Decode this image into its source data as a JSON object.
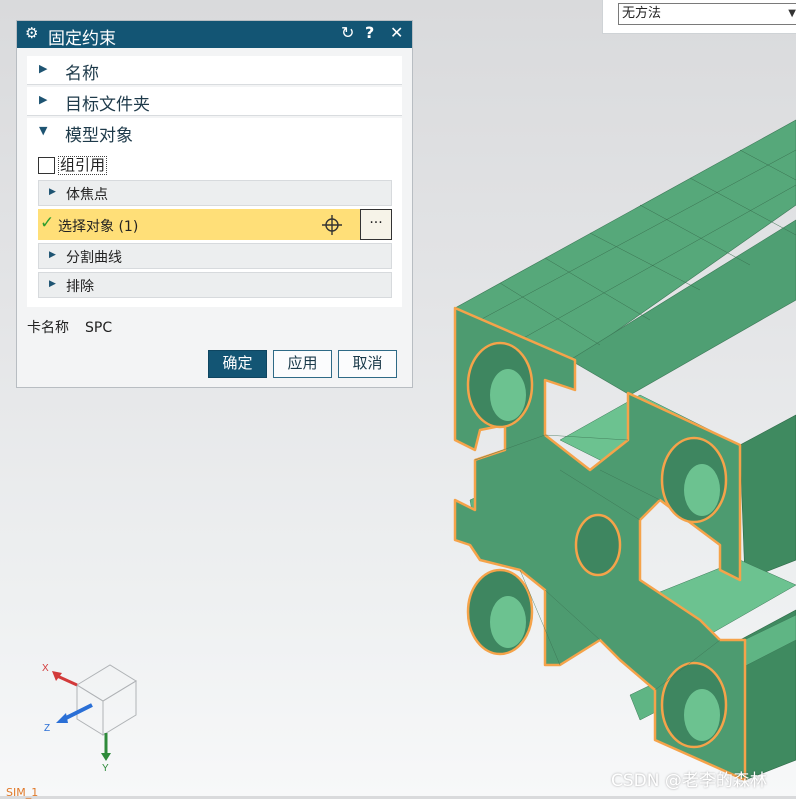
{
  "method_dropdown": {
    "value": "无方法"
  },
  "dialog": {
    "title": "固定约束",
    "icons": {
      "title": "gear-icon",
      "reset": "reset-icon",
      "help": "help-icon",
      "close": "close-icon"
    },
    "help_label": "?",
    "close_label": "✕",
    "sections": [
      {
        "label": "名称",
        "expanded": false
      },
      {
        "label": "目标文件夹",
        "expanded": false
      },
      {
        "label": "模型对象",
        "expanded": true
      }
    ],
    "group_reference": {
      "label": "组引用",
      "checked": false
    },
    "sub_groups": {
      "body_focus": "体焦点",
      "select_object": "选择对象 (1)",
      "split_curve": "分割曲线",
      "exclude": "排除"
    },
    "more_label": "···",
    "card_name": {
      "label": "卡名称",
      "value": "SPC"
    },
    "buttons": {
      "ok": "确定",
      "apply": "应用",
      "cancel": "取消"
    }
  },
  "triad": {
    "x": "X",
    "y": "Y",
    "z": "Z"
  },
  "status_text": "SIM_1",
  "watermark": "CSDN @老李的森林",
  "colors": {
    "title_bar": "#135574",
    "selection_highlight": "#ffdf78",
    "model_face": "#4d9b70",
    "model_face_light": "#64be8a",
    "edge_highlight": "#f5a34a"
  }
}
